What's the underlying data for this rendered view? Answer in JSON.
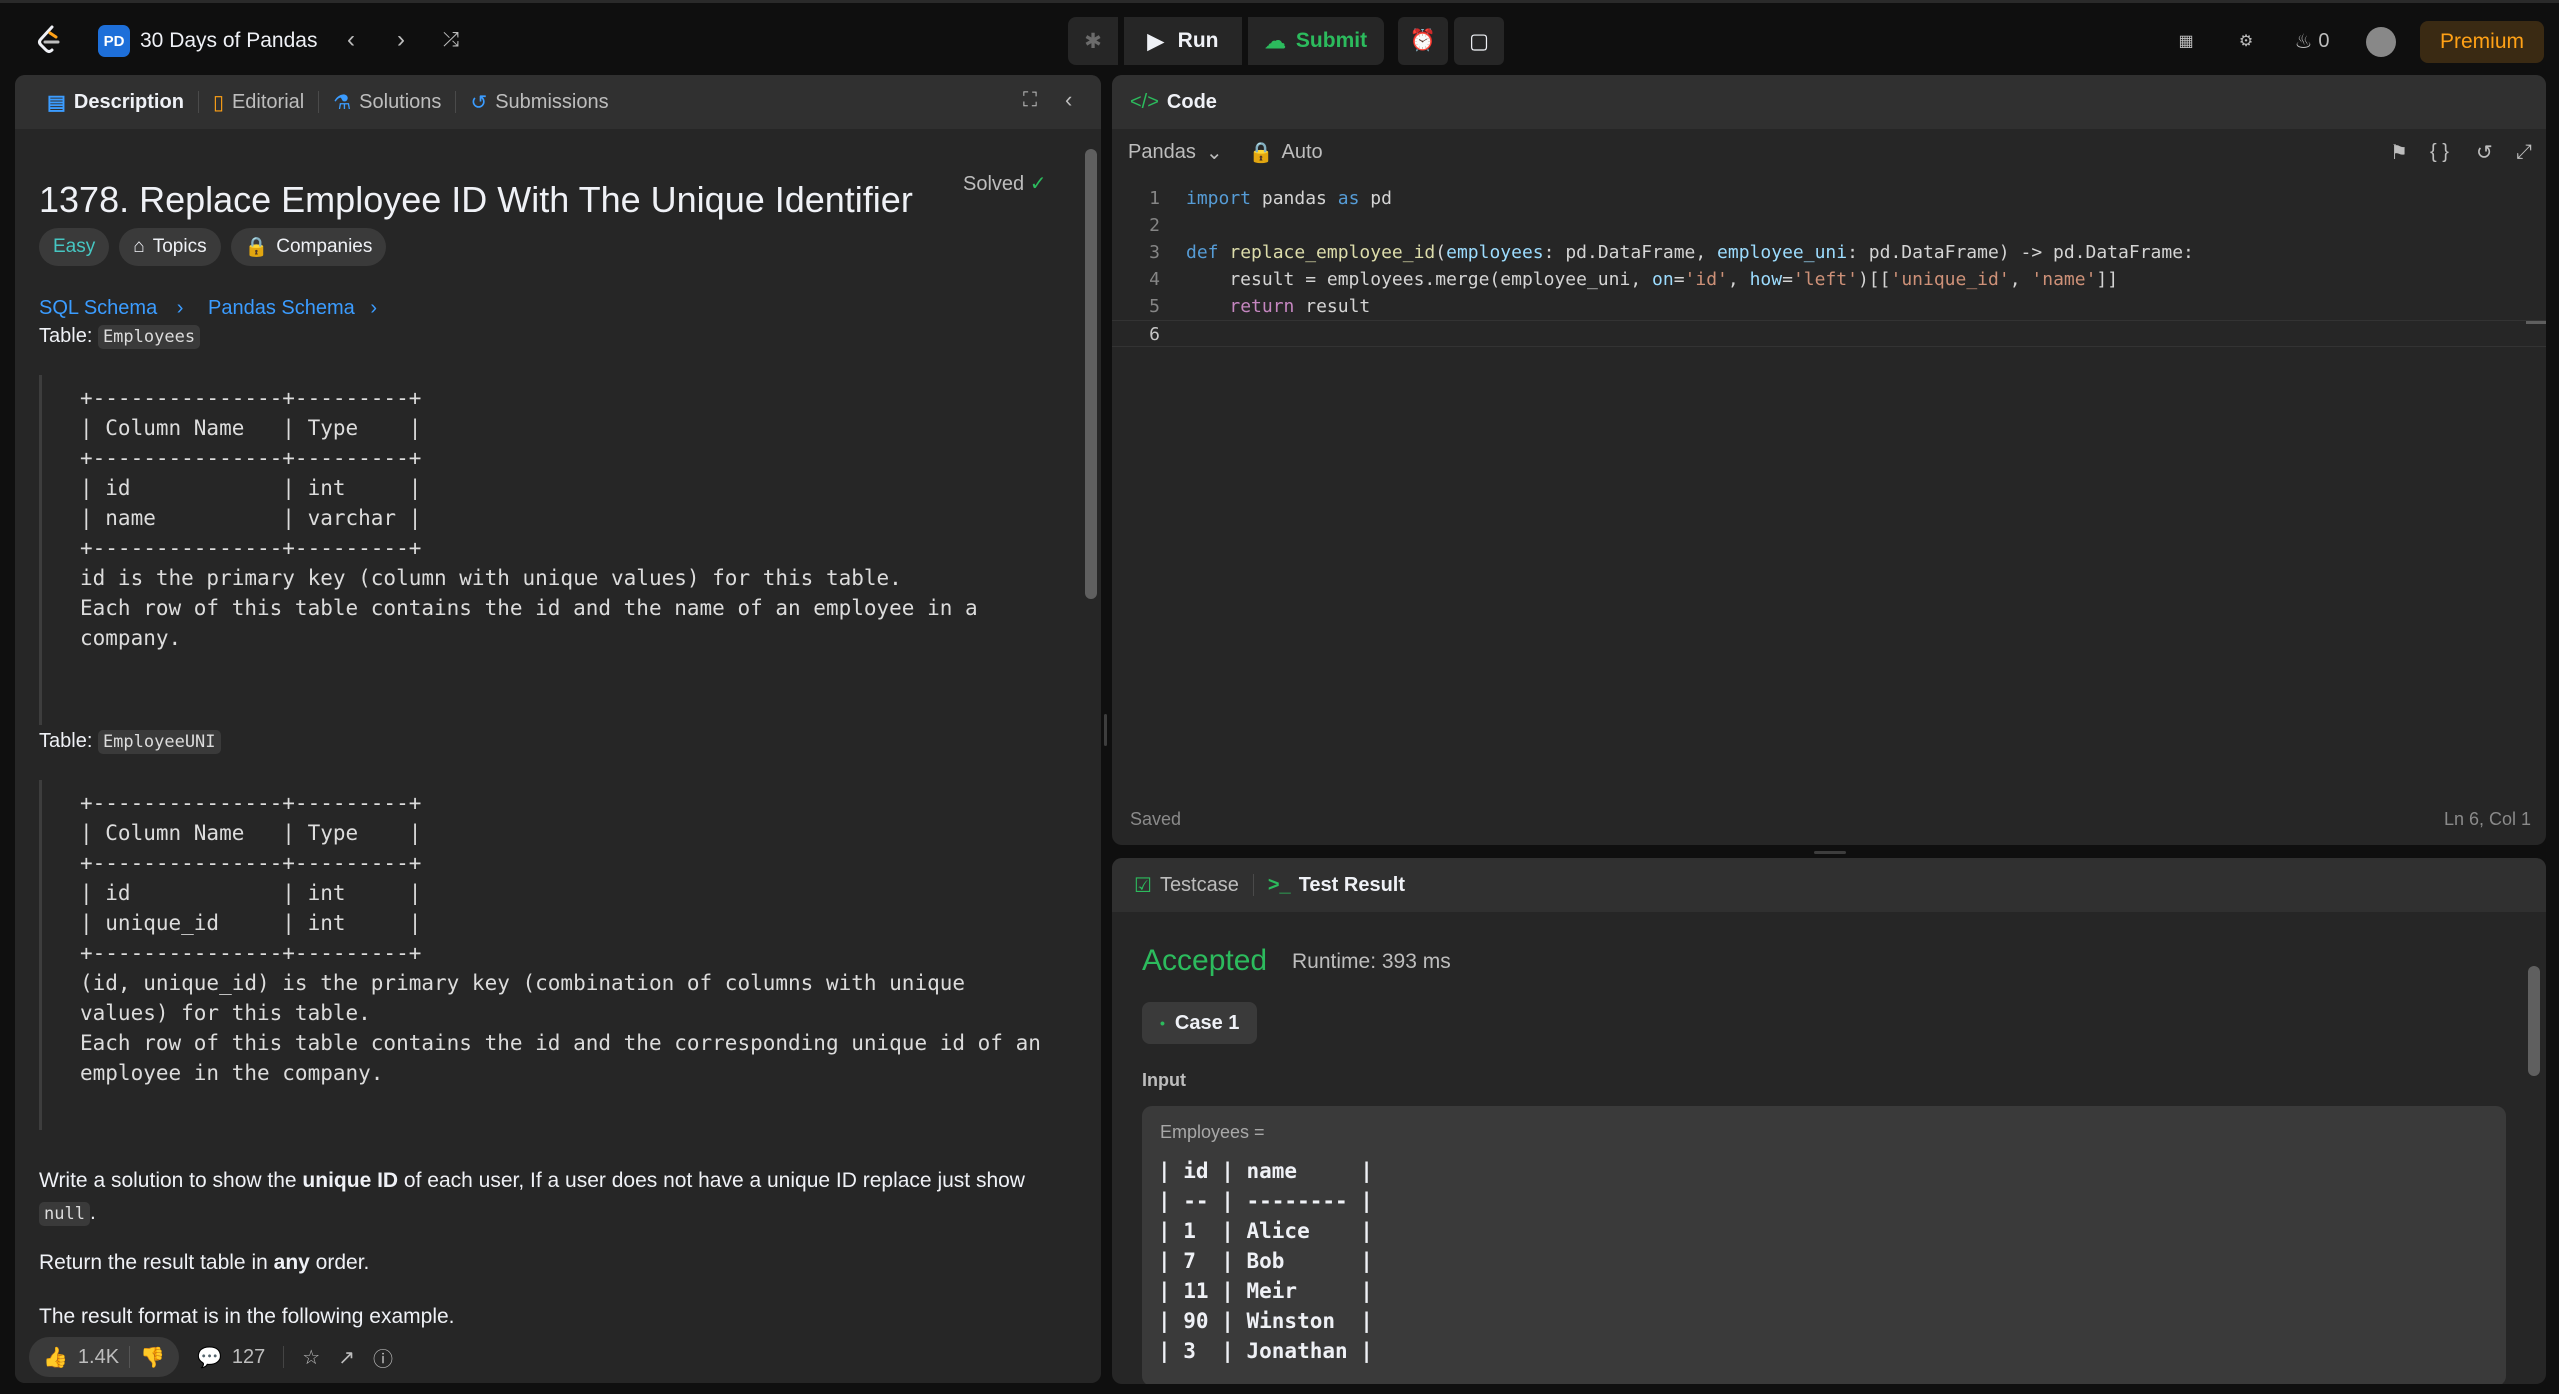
{
  "topbar": {
    "title": "30 Days of Pandas",
    "pd_badge": "PD",
    "run_label": "Run",
    "submit_label": "Submit",
    "streak_count": "0",
    "premium_label": "Premium"
  },
  "description": {
    "tabs": [
      "Description",
      "Editorial",
      "Solutions",
      "Submissions"
    ],
    "title": "1378. Replace Employee ID With The Unique Identifier",
    "solved_label": "Solved",
    "difficulty": "Easy",
    "topics_label": "Topics",
    "companies_label": "Companies",
    "sql_schema": "SQL Schema",
    "pandas_schema": "Pandas Schema",
    "table1_prefix": "Table:",
    "table1_name": "Employees",
    "table1_pre": "+---------------+---------+\n| Column Name   | Type    |\n+---------------+---------+\n| id            | int     |\n| name          | varchar |\n+---------------+---------+\nid is the primary key (column with unique values) for this table.\nEach row of this table contains the id and the name of an employee in a\ncompany.",
    "table2_prefix": "Table:",
    "table2_name": "EmployeeUNI",
    "table2_pre": "+---------------+---------+\n| Column Name   | Type    |\n+---------------+---------+\n| id            | int     |\n| unique_id     | int     |\n+---------------+---------+\n(id, unique_id) is the primary key (combination of columns with unique\nvalues) for this table.\nEach row of this table contains the id and the corresponding unique id of an\nemployee in the company.",
    "para1_a": "Write a solution to show the ",
    "para1_bold": "unique ID",
    "para1_b": " of each user, If a user does not have a unique ID replace just show",
    "para1_code": "null",
    "para1_end": ".",
    "para2_a": "Return the result table in ",
    "para2_bold": "any",
    "para2_b": " order.",
    "para3": "The result format is in the following example.",
    "likes": "1.4K",
    "comments": "127"
  },
  "code": {
    "header": "Code",
    "language": "Pandas",
    "mode": "Auto",
    "line_numbers": [
      "1",
      "2",
      "3",
      "4",
      "5",
      "6"
    ],
    "status_left": "Saved",
    "status_right": "Ln 6, Col 1"
  },
  "result": {
    "tabs": [
      "Testcase",
      "Test Result"
    ],
    "status": "Accepted",
    "runtime": "Runtime: 393 ms",
    "case_label": "Case 1",
    "input_label": "Input",
    "input_var": "Employees =",
    "input_table": "| id | name     |\n| -- | -------- |\n| 1  | Alice    |\n| 7  | Bob      |\n| 11 | Meir     |\n| 90 | Winston  |\n| 3  | Jonathan |"
  },
  "colors": {
    "accent_orange": "#ffa116",
    "success_green": "#2cbb5d",
    "easy_teal": "#46c6c2",
    "link_blue": "#3b9cff"
  }
}
